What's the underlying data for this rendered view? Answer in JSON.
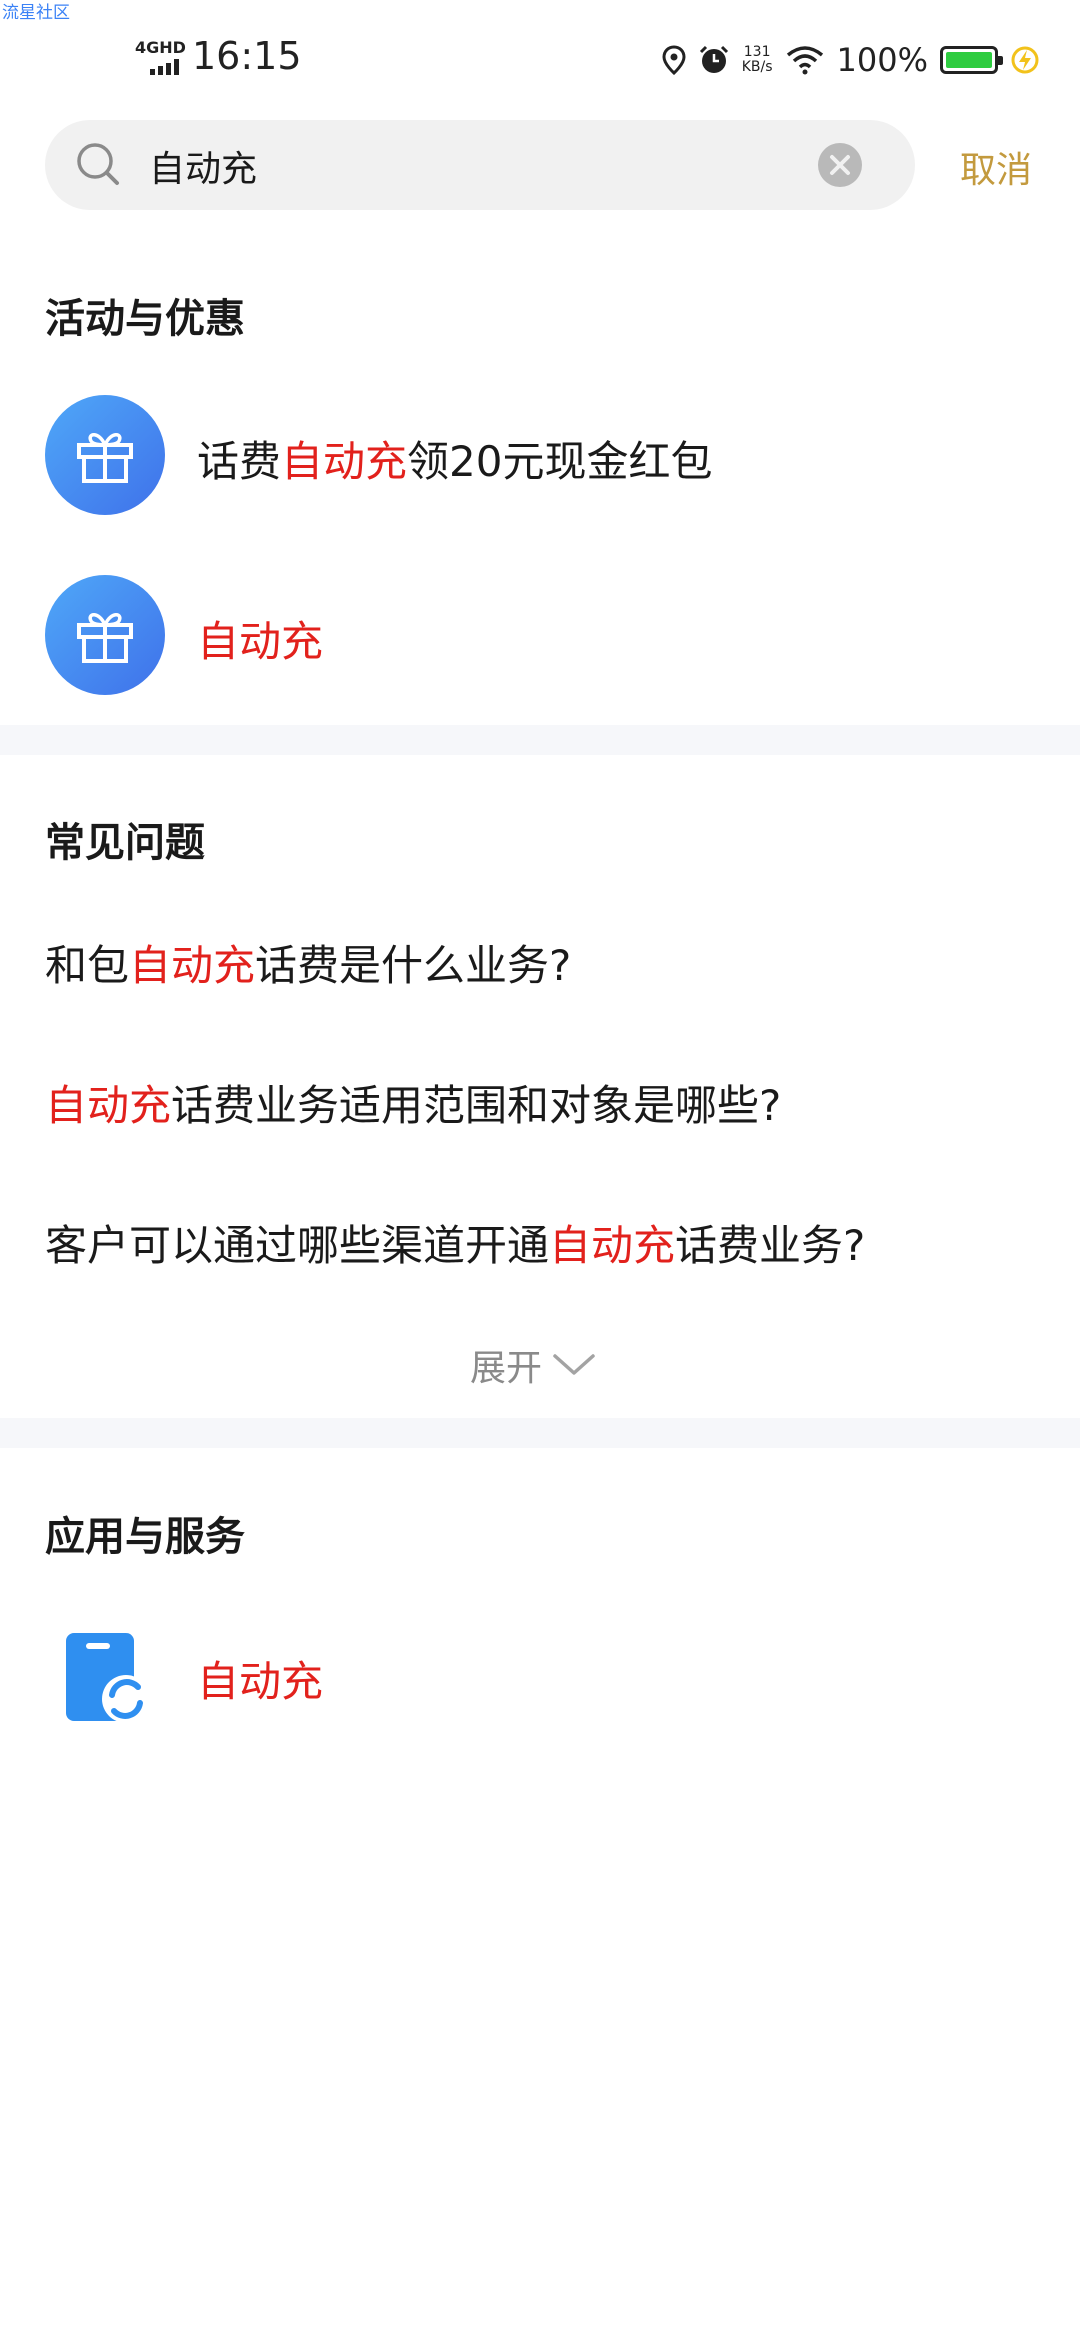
{
  "watermark": "流星社区",
  "status_bar": {
    "network": "4GHD",
    "time": "16:15",
    "speed_value": "131",
    "speed_unit": "KB/s",
    "battery_percent": "100%",
    "battery_level": 1.0,
    "icons": [
      "location-icon",
      "alarm-icon",
      "wifi-icon",
      "battery-icon",
      "charging-icon"
    ]
  },
  "search": {
    "query": "自动充",
    "cancel_label": "取消"
  },
  "promotions": {
    "title": "活动与优惠",
    "items": [
      {
        "before": "话费",
        "highlight": "自动充",
        "after": "领20元现金红包",
        "icon": "gift-icon"
      },
      {
        "before": "",
        "highlight": "自动充",
        "after": "",
        "icon": "gift-icon"
      }
    ]
  },
  "faq": {
    "title": "常见问题",
    "items": [
      {
        "before": "和包",
        "highlight": "自动充",
        "after": "话费是什么业务?"
      },
      {
        "before": "",
        "highlight": "自动充",
        "after": "话费业务适用范围和对象是哪些?"
      },
      {
        "before": "客户可以通过哪些渠道开通",
        "highlight": "自动充",
        "after": "话费业务?"
      }
    ],
    "expand_label": "展开"
  },
  "apps": {
    "title": "应用与服务",
    "items": [
      {
        "before": "",
        "highlight": "自动充",
        "after": "",
        "icon": "phone-refresh-icon"
      }
    ]
  },
  "colors": {
    "highlight": "#e2211c",
    "cancel": "#c39a3e",
    "icon_blue": "#3f71ea",
    "app_blue": "#2f8ff0",
    "divider": "#f6f7fa"
  }
}
